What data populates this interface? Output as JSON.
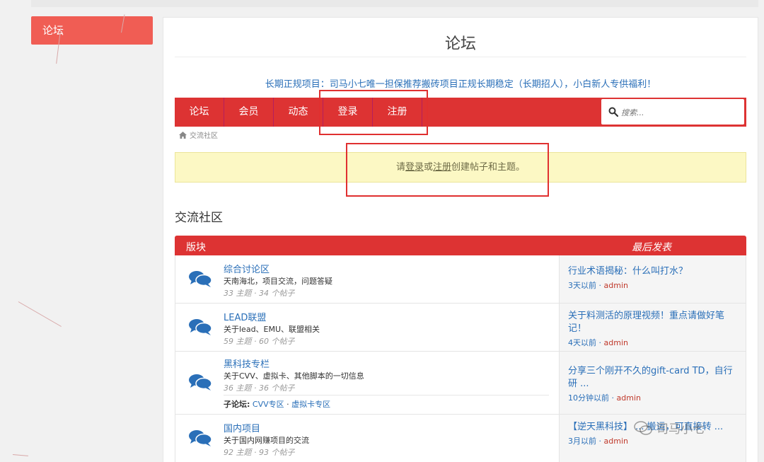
{
  "sidebar": {
    "forum_label": "论坛"
  },
  "page": {
    "title": "论坛"
  },
  "notice": "长期正规项目：司马小七唯一担保推荐搬砖项目正规长期稳定（长期招人），小白新人专供福利！",
  "nav": {
    "items": [
      {
        "label": "论坛"
      },
      {
        "label": "会员"
      },
      {
        "label": "动态"
      },
      {
        "label": "登录"
      },
      {
        "label": "注册"
      }
    ],
    "search_placeholder": "搜索..."
  },
  "breadcrumb": {
    "home_label": "交流社区"
  },
  "alert": {
    "prefix": "请",
    "login_link": "登录",
    "or": "或",
    "register_link": "注册",
    "suffix": "创建帖子和主题。"
  },
  "section_title": "交流社区",
  "table": {
    "col_board": "版块",
    "col_last_post": "最后发表",
    "rows": [
      {
        "name": "综合讨论区",
        "desc": "天南海北，项目交流，问题答疑",
        "stats": "33 主题 · 34 个帖子",
        "last_title": "行业术语揭秘：什么叫打水？",
        "last_time": "3天以前",
        "last_user": "admin"
      },
      {
        "name": "LEAD联盟",
        "desc": "关于lead、EMU、联盟相关",
        "stats": "59 主题 · 60 个帖子",
        "last_title": "关于料测活的原理视频！重点请做好笔记！",
        "last_time": "4天以前",
        "last_user": "admin"
      },
      {
        "name": "黑科技专栏",
        "desc": "关于CVV、虚拟卡、其他脚本的一切信息",
        "stats": "36 主题 · 36 个帖子",
        "sub_label": "子论坛:",
        "sub_1": "CVV专区",
        "sub_2": "虚拟卡专区",
        "last_title": "分享三个刚开不久的gift-card TD，自行研 ...",
        "last_time": "10分钟以前",
        "last_user": "admin"
      },
      {
        "name": "国内项目",
        "desc": "关于国内网赚项目的交流",
        "stats": "92 主题 · 93 个帖子",
        "last_title": "【逆天黑科技】 ... 搬运，可直接转 ...",
        "last_time": "3月以前",
        "last_user": "admin"
      }
    ]
  },
  "watermark": "司马小七",
  "colors": {
    "brand_red": "#dd3333",
    "link_blue": "#2a6fb8",
    "alert_bg": "#fcf8c4",
    "sidebar_btn": "#f05d54"
  }
}
